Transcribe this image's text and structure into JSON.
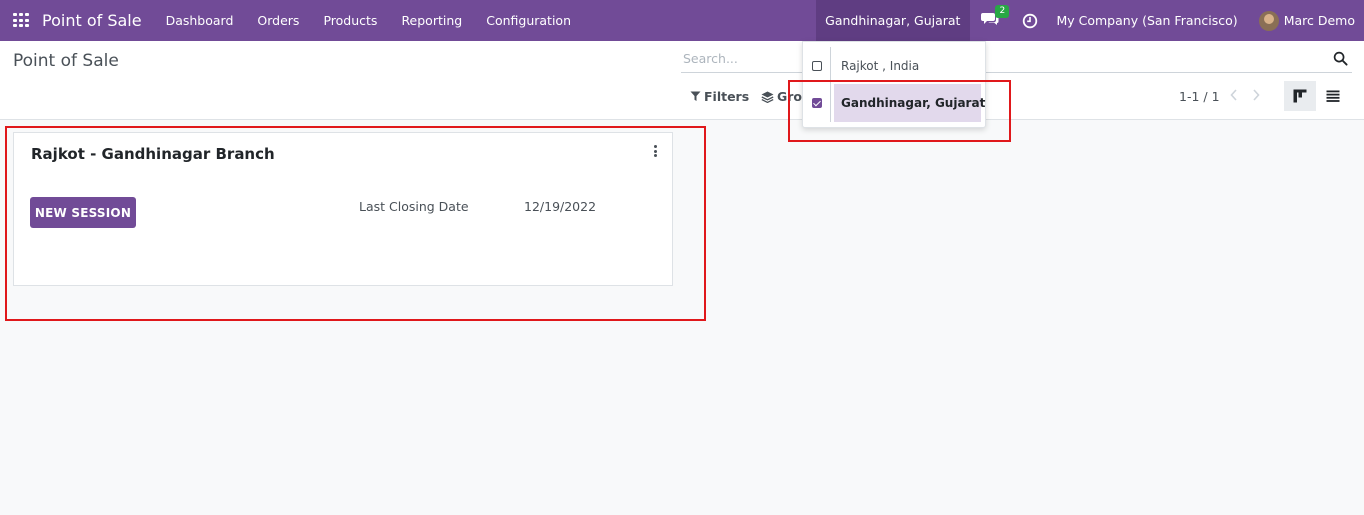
{
  "navbar": {
    "brand": "Point of Sale",
    "menu": [
      "Dashboard",
      "Orders",
      "Products",
      "Reporting",
      "Configuration"
    ],
    "branch": "Gandhinagar, Gujarat",
    "chat_count": "2",
    "company": "My Company (San Francisco)",
    "user": "Marc Demo"
  },
  "control_panel": {
    "breadcrumb": "Point of Sale",
    "search_placeholder": "Search...",
    "filters_label": "Filters",
    "groupby_label": "Gro",
    "pager": "1-1 / 1"
  },
  "card": {
    "title": "Rajkot - Gandhinagar Branch",
    "button_label": "NEW SESSION",
    "closing_label": "Last Closing Date",
    "closing_value": "12/19/2022"
  },
  "branch_dropdown": {
    "items": [
      {
        "label": "Rajkot , India",
        "checked": false
      },
      {
        "label": "Gandhinagar, Gujarat",
        "checked": true
      }
    ]
  },
  "colors": {
    "brand": "#714b97",
    "highlight": "#e0181b",
    "badge": "#28a745"
  }
}
